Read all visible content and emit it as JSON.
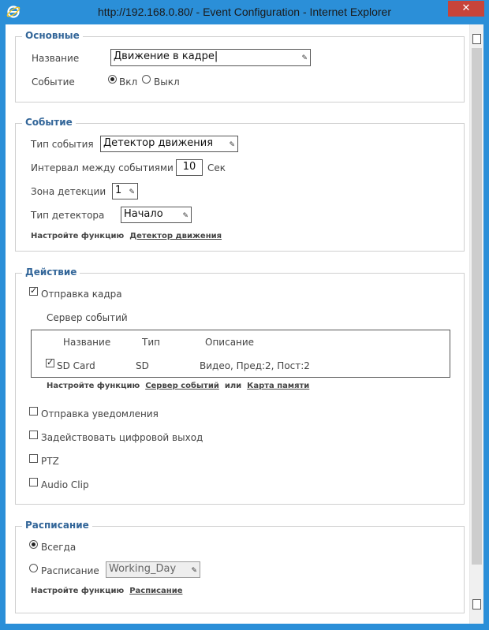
{
  "window": {
    "title": "http://192.168.0.80/ - Event Configuration - Internet Explorer",
    "close_label": "✕"
  },
  "basic": {
    "legend": "Основные",
    "name_label": "Название",
    "name_value": "Движение в кадре",
    "event_label": "Событие",
    "on_label": "Вкл",
    "off_label": "Выкл",
    "selected": "on"
  },
  "event": {
    "legend": "Событие",
    "type_label": "Тип события",
    "type_value": "Детектор движения",
    "interval_label": "Интервал между событиями",
    "interval_value": "10",
    "interval_unit": "Сек",
    "zone_label": "Зона детекции",
    "zone_value": "1",
    "detector_label": "Тип детектора",
    "detector_value": "Начало",
    "hint_prefix": "Настройте функцию",
    "hint_link": "Детектор движения"
  },
  "action": {
    "legend": "Действие",
    "send_frame_label": "Отправка кадра",
    "server_label": "Сервер событий",
    "columns": [
      "Название",
      "Тип",
      "Описание"
    ],
    "rows": [
      {
        "name": "SD Card",
        "type": "SD",
        "desc": "Видео, Пред:2, Пост:2"
      }
    ],
    "hint_prefix": "Настройте функцию",
    "hint_link1": "Сервер событий",
    "hint_or": "или",
    "hint_link2": "Карта памяти",
    "notify_label": "Отправка уведомления",
    "digital_out_label": "Задействовать цифровой выход",
    "ptz_label": "PTZ",
    "audio_label": "Audio Clip"
  },
  "schedule": {
    "legend": "Расписание",
    "always_label": "Всегда",
    "schedule_label": "Расписание",
    "schedule_value": "Working_Day",
    "hint_prefix": "Настройте функцию",
    "hint_link": "Расписание"
  }
}
